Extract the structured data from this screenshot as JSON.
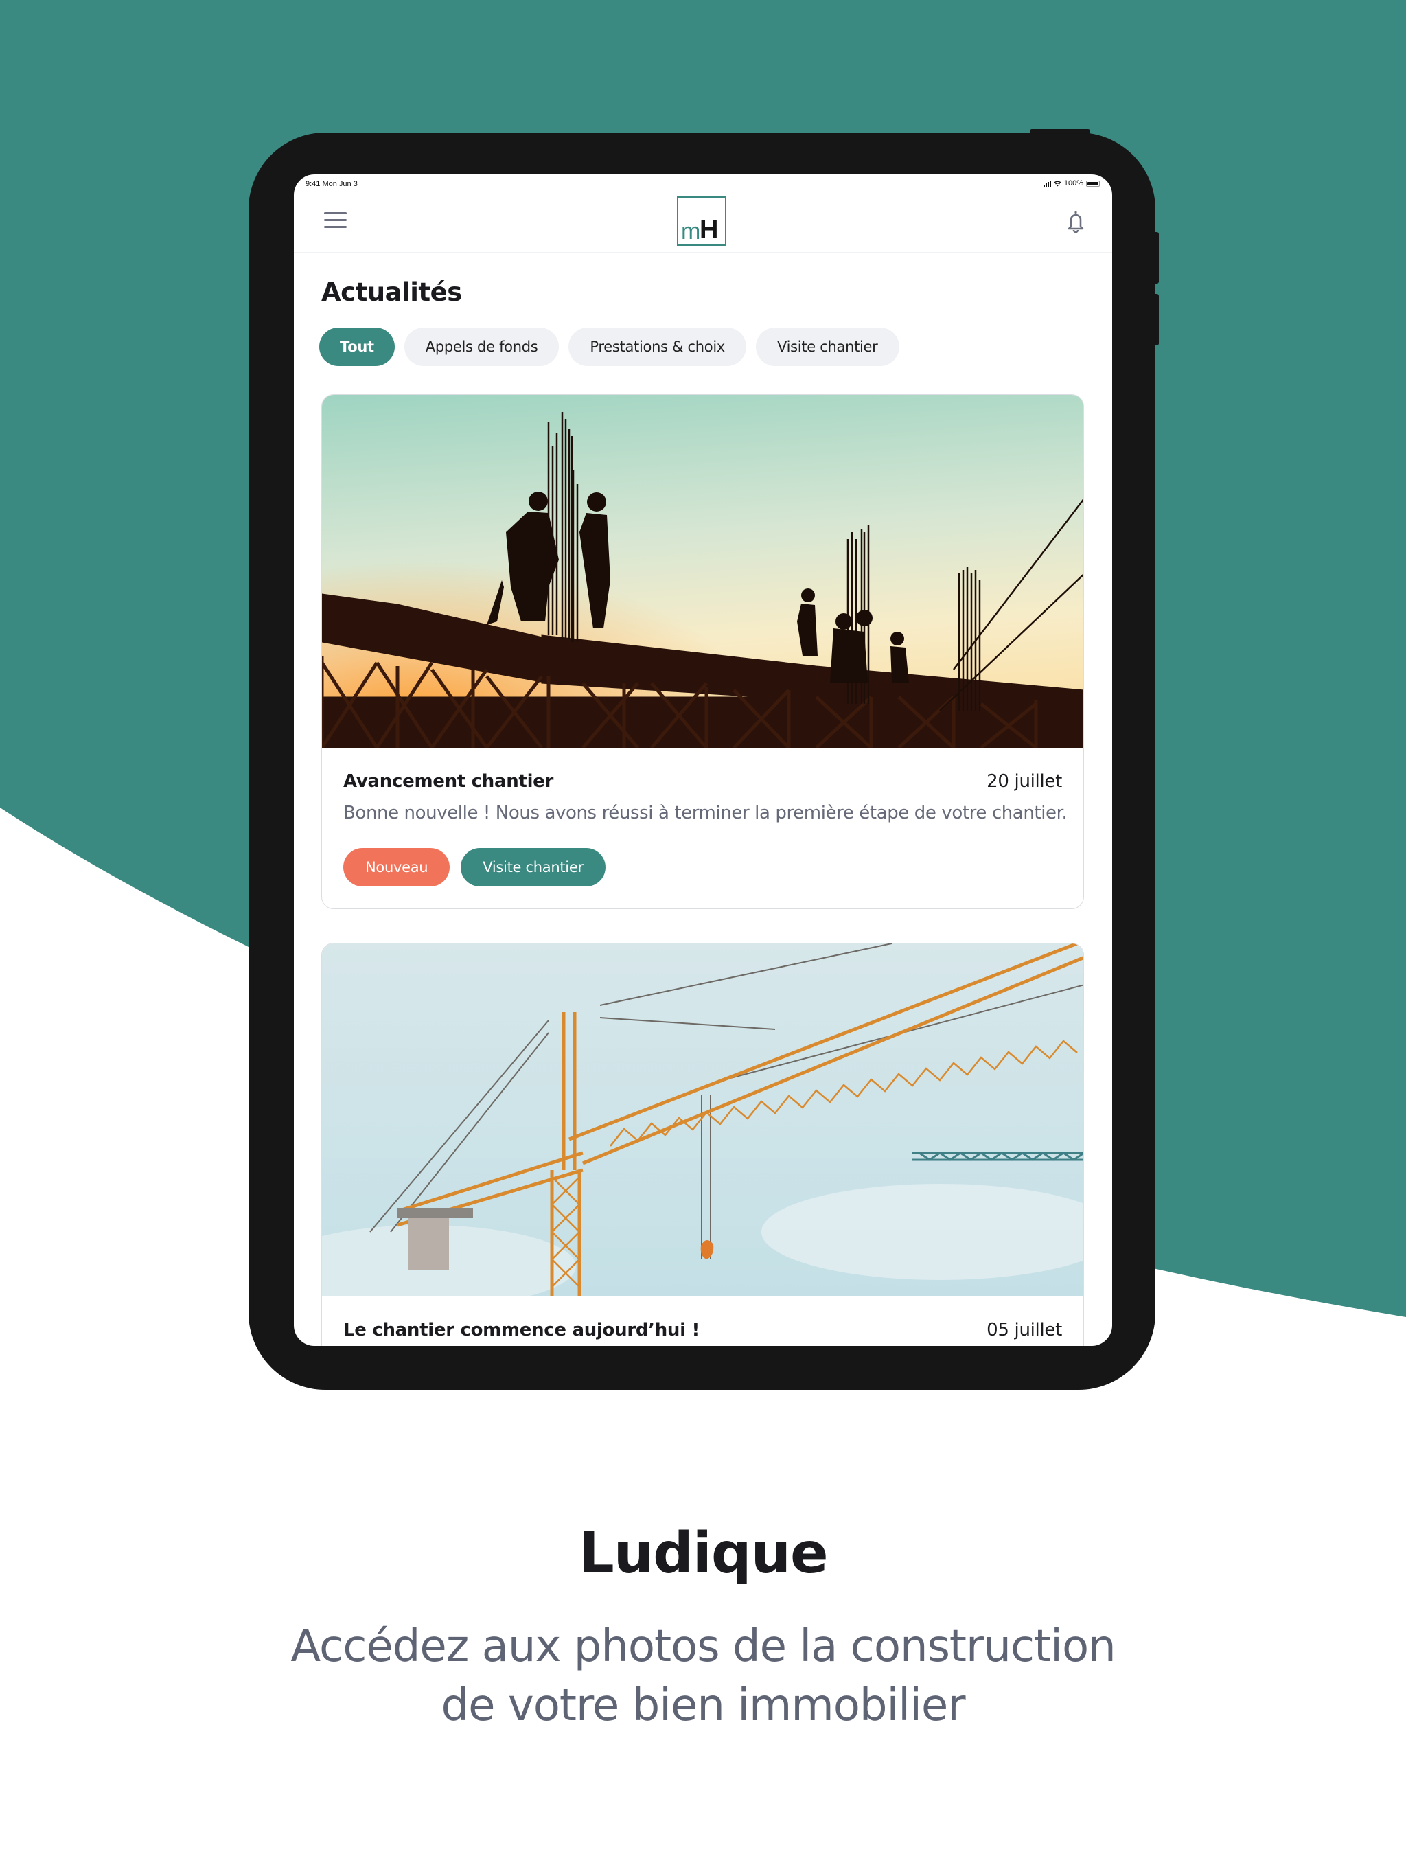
{
  "colors": {
    "brand_teal": "#3a8a82",
    "badge_new": "#f0735a",
    "device_frame": "#161616",
    "chip_inactive": "#f0f1f4",
    "text_dark": "#1b1b1f",
    "text_muted": "#666a78"
  },
  "status_bar": {
    "time": "9:41 Mon Jun 3",
    "battery": "100%"
  },
  "header": {
    "menu_icon": "hamburger-menu-icon",
    "logo_m": "m",
    "logo_h": "H",
    "notifications_icon": "bell-icon"
  },
  "page": {
    "title": "Actualités"
  },
  "filters": [
    {
      "label": "Tout",
      "active": true
    },
    {
      "label": "Appels de fonds",
      "active": false
    },
    {
      "label": "Prestations & choix",
      "active": false
    },
    {
      "label": "Visite chantier",
      "active": false
    }
  ],
  "news": [
    {
      "image": "construction-workers-silhouette-sunset",
      "title": "Avancement chantier",
      "date": "20 juillet",
      "description": "Bonne nouvelle ! Nous avons réussi à terminer la première étape de votre chantier.",
      "badges": {
        "new": "Nouveau",
        "category": "Visite chantier"
      }
    },
    {
      "image": "tower-crane-sky",
      "title": "Le chantier commence aujourd’hui !",
      "date": "05 juillet"
    }
  ],
  "promo": {
    "title": "Ludique",
    "subtitle_line1": "Accédez aux photos de la construction",
    "subtitle_line2": "de votre bien immobilier"
  }
}
